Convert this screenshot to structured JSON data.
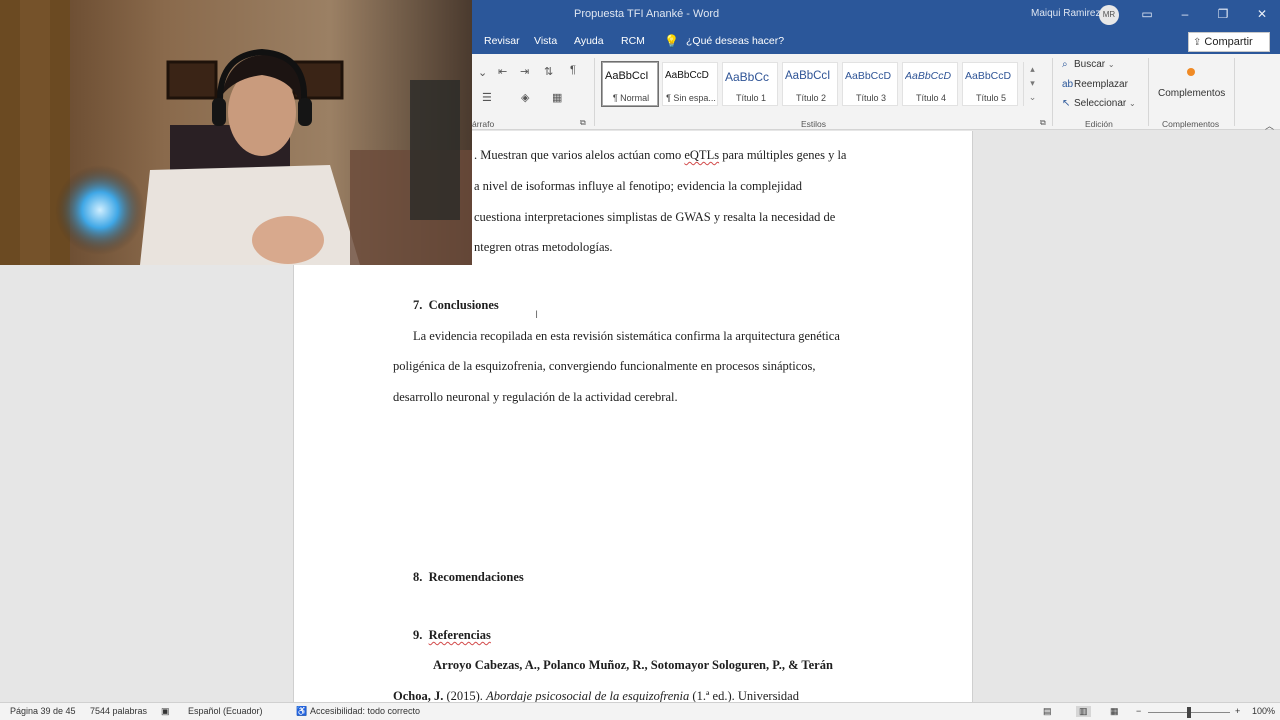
{
  "window": {
    "title": "Propuesta TFI Ananké  -  Word",
    "user_name": "Maiqui Ramirez",
    "user_initials": "MR",
    "controls": [
      "restore-ribbon",
      "minimize",
      "maximize",
      "close"
    ]
  },
  "menu": {
    "tabs": [
      "Revisar",
      "Vista",
      "Ayuda",
      "RCM"
    ],
    "tell_me": "¿Qué deseas hacer?",
    "share": "Compartir"
  },
  "ribbon": {
    "paragraph_group": "árrafo",
    "styles_group": "Estilos",
    "editing_group": "Edición",
    "addins_group": "Complementos",
    "styles": [
      {
        "sample": "AaBbCcI",
        "name": "¶ Normal"
      },
      {
        "sample": "AaBbCcD",
        "name": "¶ Sin espa..."
      },
      {
        "sample": "AaBbCc",
        "name": "Título 1"
      },
      {
        "sample": "AaBbCcI",
        "name": "Título 2"
      },
      {
        "sample": "AaBbCcD",
        "name": "Título 3"
      },
      {
        "sample": "AaBbCcD",
        "name": "Título 4"
      },
      {
        "sample": "AaBbCcD",
        "name": "Título 5"
      }
    ],
    "editing": {
      "find": "Buscar",
      "replace": "Reemplazar",
      "select": "Seleccionar"
    },
    "addins_button": "Complementos"
  },
  "document": {
    "para_top": {
      "line1": ". Muestran que varios alelos actúan como",
      "line1_eqtl": "eQTLs",
      "line1_end": "para múltiples genes y la",
      "line2": "a nivel de isoformas influye al fenotipo; evidencia la complejidad",
      "line3": "cuestiona interpretaciones simplistas de GWAS y resalta la necesidad de",
      "line4": "ntegren otras metodologías."
    },
    "section7": {
      "number": "7.",
      "title": "Conclusiones"
    },
    "conclusion": {
      "line1": "La evidencia recopilada en esta revisión sistemática confirma la arquitectura genética",
      "line2": "poligénica de la esquizofrenia, convergiendo funcionalmente en procesos sinápticos,",
      "line3": "desarrollo neuronal y regulación de la actividad cerebral."
    },
    "section8": {
      "number": "8.",
      "title": "Recomendaciones"
    },
    "section9": {
      "number": "9.",
      "title": "Referencias"
    },
    "reference": {
      "authors_line1": "Arroyo Cabezas, A., Polanco Muñoz, R., Sotomayor Sologuren, P., & Terán",
      "authors_line2": "Ochoa, J.",
      "year": " (2015). ",
      "book_title": "Abordaje psicosocial de la esquizofrenia",
      "rest": " (1.ª ed.). Universidad"
    }
  },
  "status": {
    "page": "Página 39 de 45",
    "words": "7544 palabras",
    "language": "Español (Ecuador)",
    "accessibility": "Accesibilidad: todo correcto",
    "zoom": "100%"
  }
}
